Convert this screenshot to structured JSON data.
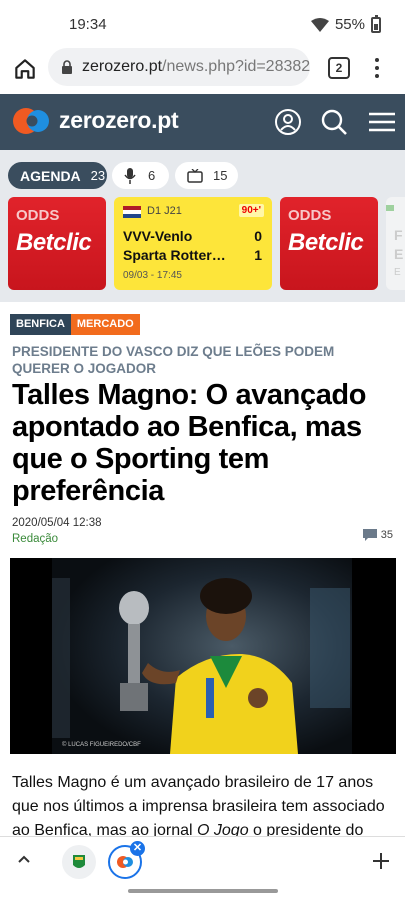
{
  "status_bar": {
    "time": "19:34",
    "battery": "55%"
  },
  "browser": {
    "url_host": "zerozero.pt",
    "url_path": "/news.php?id=28382",
    "tab_count": "2"
  },
  "site": {
    "name": "zerozero.pt"
  },
  "agenda": {
    "label": "AGENDA",
    "count": "23",
    "audio_count": "6",
    "tv_count": "15"
  },
  "ads": {
    "top": "ODDS",
    "brand": "Betclic"
  },
  "match": {
    "competition": "D1 J21",
    "live": "90+'",
    "home_team": "VVV-Venlo",
    "home_score": "0",
    "away_team": "Sparta Rotterdam",
    "away_score": "1",
    "datetime": "09/03 - 17:45"
  },
  "partial_card": {
    "l1": "F",
    "l2": "E",
    "l3": "E"
  },
  "article": {
    "tags": [
      "BENFICA",
      "MERCADO"
    ],
    "kicker": "PRESIDENTE DO VASCO DIZ QUE LEÕES PODEM QUERER O JOGADOR",
    "headline": "Talles Magno: O avançado apontado ao Benfica, mas que o Sporting tem preferência",
    "date": "2020/05/04 12:38",
    "author": "Redação",
    "comments": "35",
    "photo_credit": "© LUCAS FIGUEIREDO/CBF",
    "body_1": "Talles Magno é um avançado brasileiro de 17 anos que nos últimos a imprensa brasileira tem associado ao Benfica, mas ao jornal ",
    "body_em": "O Jogo",
    "body_2": " o presidente do Vasco"
  },
  "colors": {
    "header_bg": "#3a4d5e",
    "tag_benfica": "#2f4558",
    "tag_mercado": "#f26b1d",
    "betclic_red": "#d81b23",
    "match_yellow": "#fde53a",
    "author_green": "#3a8a3a"
  }
}
